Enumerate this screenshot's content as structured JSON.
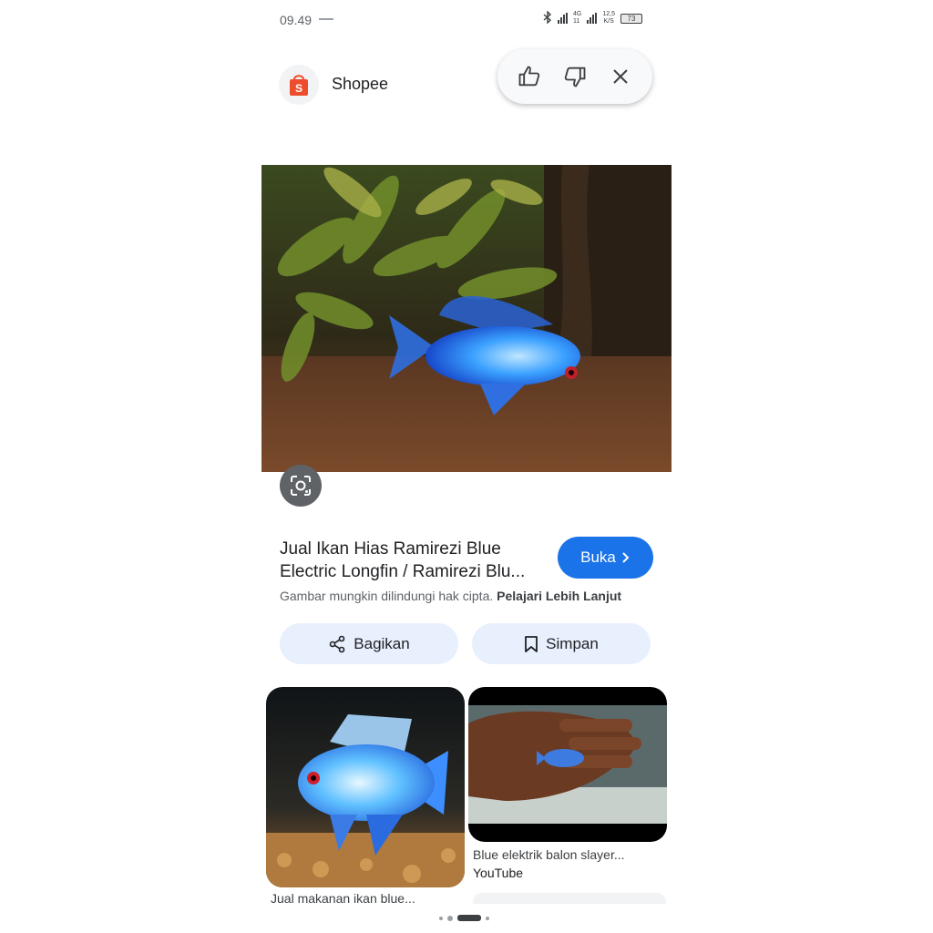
{
  "status": {
    "time": "09.49",
    "network_a": "4G",
    "network_b": "12,5",
    "network_unit": "K/S",
    "battery": "73"
  },
  "source": {
    "name": "Shopee",
    "logo_icon": "shopping-bag-icon",
    "brand_color": "#ee4d2d"
  },
  "feedback": {
    "like_icon": "thumbs-up-icon",
    "dislike_icon": "thumbs-down-icon",
    "close_icon": "close-icon"
  },
  "result": {
    "title_line1": "Jual Ikan Hias Ramirezi Blue",
    "title_line2": "Electric Longfin / Ramirezi Blu...",
    "open_button": "Buka",
    "copyright_text": "Gambar mungkin dilindungi hak cipta.",
    "learn_more": "Pelajari Lebih Lanjut"
  },
  "actions": {
    "share_label": "Bagikan",
    "save_label": "Simpan"
  },
  "related": [
    {
      "caption": "Jual makanan ikan blue..."
    },
    {
      "caption": "Blue elektrik balon slayer...",
      "site": "YouTube"
    }
  ],
  "colors": {
    "accent": "#1a73e8",
    "pill_bg": "#e8f0fe"
  }
}
